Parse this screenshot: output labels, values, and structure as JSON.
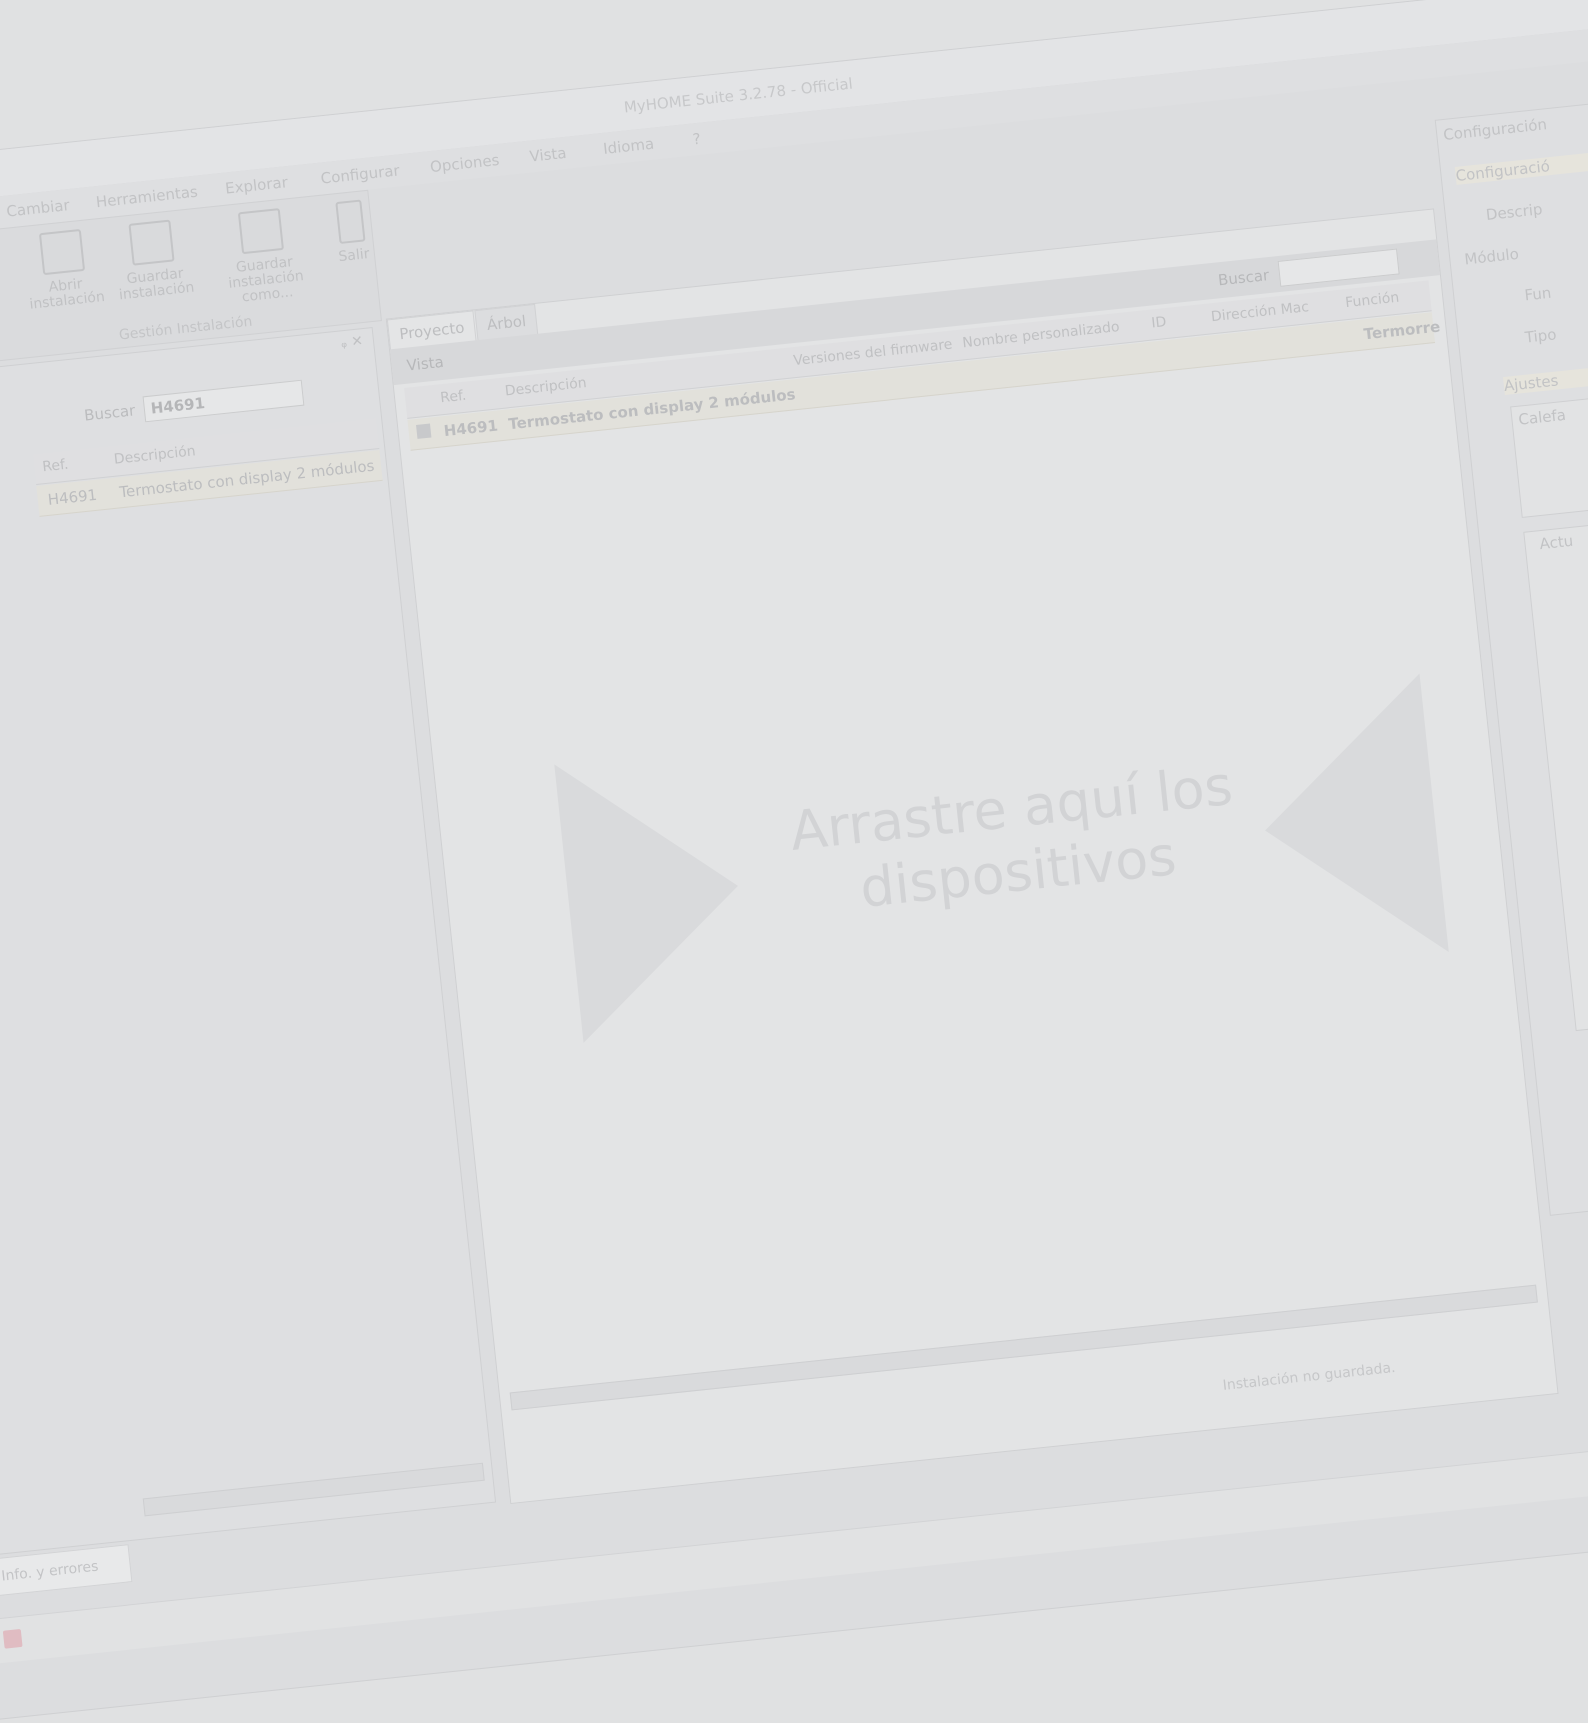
{
  "window": {
    "title": "MyHOME Suite 3.2.78 - Official"
  },
  "menu": [
    "Cambiar",
    "Herramientas",
    "Explorar",
    "Configurar",
    "Opciones",
    "Vista",
    "Idioma",
    "?"
  ],
  "ribbon": {
    "open_label": "Abrir instalación",
    "save_label": "Guardar instalación",
    "save_as_label": "Guardar instalación como...",
    "exit_label": "Salir",
    "group_label": "Gestión Instalación"
  },
  "catalog": {
    "search_label": "Buscar",
    "search_value": "H4691",
    "columns": [
      "Ref.",
      "Descripción"
    ],
    "rows": [
      {
        "ref": "H4691",
        "desc": "Termostato con display 2 módulos"
      }
    ]
  },
  "project": {
    "tabs": [
      "Proyecto",
      "Árbol"
    ],
    "view_label": "Vista",
    "search_label": "Buscar",
    "columns": [
      "Ref.",
      "Descripción",
      "Versiones del firmware",
      "Nombre personalizado",
      "ID",
      "Dirección Mac",
      "Función"
    ],
    "rows": [
      {
        "ref": "H4691",
        "desc": "Termostato con display 2 módulos",
        "func": "Termorre"
      }
    ],
    "drop_hint_1": "Arrastre aquí los",
    "drop_hint_2": "dispositivos",
    "status": "Instalación no guardada."
  },
  "config": {
    "header": "Configuración",
    "sub_header": "Configuració",
    "labels": [
      "Descrip",
      "Módulo",
      "Fun",
      "Tipo",
      "Ajustes",
      "Calefa",
      "Actu"
    ]
  },
  "bottom": {
    "tab_label": "Info. y errores"
  },
  "colors": {
    "accent": "#e6e4dc",
    "ok": "#b8d9bd",
    "save": "#e0bcc2"
  }
}
